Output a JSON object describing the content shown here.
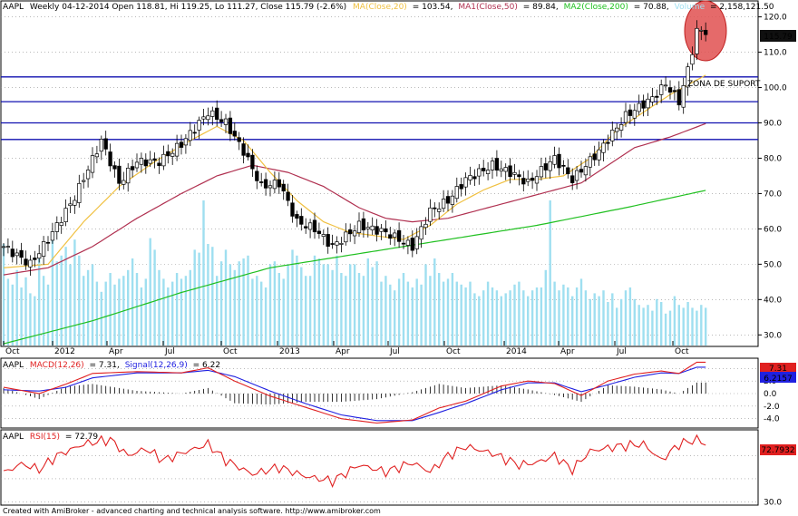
{
  "header": {
    "symbol": "AAPL",
    "info": "Weekly 04-12-2014 Open 118.81, Hi 119.25, Lo 111.27, Close 115.79 (-2.6%)",
    "ma_label": "MA(Close,20)",
    "ma_value": "= 103.54,",
    "ma1_label": "MA1(Close,50)",
    "ma1_value": "= 89.84,",
    "ma2_label": "MA2(Close,200)",
    "ma2_value": "= 70.88,",
    "volume_label": "Volume",
    "volume_value": "= 2,158,121.50"
  },
  "macd_header": {
    "symbol": "AAPL",
    "macd_label": "MACD(12,26)",
    "macd_value": "= 7.31,",
    "signal_label": "Signal(12,26,9)",
    "signal_value": "= 6.22"
  },
  "rsi_header": {
    "symbol": "AAPL",
    "rsi_label": "RSI(15)",
    "rsi_value": "= 72.79"
  },
  "annotation": "ZONA DE SUPORT",
  "footer": "Created with AmiBroker - advanced charting and technical analysis software. http://www.amibroker.com",
  "colors": {
    "ma20": "#f0c040",
    "ma50": "#b03050",
    "ma200": "#20c020",
    "volume": "#9fdff0",
    "support": "#1010b0",
    "macd": "#e02020",
    "signal": "#2020e0",
    "rsi": "#e02020",
    "highlight": "#e02020",
    "price_box": "#101010"
  },
  "chart_data": [
    {
      "type": "candlestick",
      "title": "AAPL Weekly",
      "x": [
        "Oct",
        "2012",
        "Apr",
        "Jul",
        "Oct",
        "2013",
        "Apr",
        "Jul",
        "Oct",
        "2014",
        "Apr",
        "Jul",
        "Oct"
      ],
      "yticks": [
        "120.0",
        "110.0",
        "100.0",
        "90.0",
        "80.0",
        "70.0",
        "60.0",
        "50.0",
        "40.0",
        "30.0"
      ],
      "ylim": [
        27,
        124
      ],
      "last_close": "115.79",
      "close_anchors": [
        [
          0,
          55
        ],
        [
          6,
          50
        ],
        [
          10,
          57
        ],
        [
          16,
          69
        ],
        [
          22,
          85
        ],
        [
          26,
          73
        ],
        [
          30,
          79
        ],
        [
          35,
          79
        ],
        [
          40,
          84
        ],
        [
          46,
          93
        ],
        [
          50,
          90
        ],
        [
          54,
          82
        ],
        [
          58,
          72
        ],
        [
          62,
          73
        ],
        [
          66,
          62
        ],
        [
          70,
          60
        ],
        [
          74,
          55
        ],
        [
          80,
          61
        ],
        [
          86,
          59
        ],
        [
          92,
          55
        ],
        [
          96,
          65
        ],
        [
          100,
          68
        ],
        [
          104,
          74
        ],
        [
          110,
          78
        ],
        [
          114,
          76
        ],
        [
          118,
          73
        ],
        [
          124,
          80
        ],
        [
          128,
          74
        ],
        [
          134,
          82
        ],
        [
          140,
          92
        ],
        [
          146,
          97
        ],
        [
          149,
          101
        ],
        [
          152,
          96
        ],
        [
          154,
          105
        ],
        [
          156,
          116
        ],
        [
          158,
          116
        ]
      ],
      "support_levels": [
        103,
        96,
        90,
        85.3
      ],
      "ma20_anchors": [
        [
          0,
          49
        ],
        [
          10,
          50
        ],
        [
          18,
          62
        ],
        [
          26,
          72
        ],
        [
          34,
          79
        ],
        [
          42,
          85
        ],
        [
          48,
          89
        ],
        [
          54,
          85
        ],
        [
          60,
          76
        ],
        [
          66,
          68
        ],
        [
          72,
          62
        ],
        [
          78,
          59
        ],
        [
          84,
          58
        ],
        [
          90,
          57
        ],
        [
          96,
          61
        ],
        [
          102,
          67
        ],
        [
          108,
          71
        ],
        [
          114,
          74
        ],
        [
          120,
          74
        ],
        [
          126,
          75
        ],
        [
          132,
          80
        ],
        [
          138,
          88
        ],
        [
          144,
          93
        ],
        [
          150,
          98
        ],
        [
          158,
          103.5
        ]
      ],
      "ma50_anchors": [
        [
          0,
          47
        ],
        [
          10,
          49
        ],
        [
          20,
          55
        ],
        [
          30,
          63
        ],
        [
          40,
          70
        ],
        [
          48,
          75
        ],
        [
          56,
          78
        ],
        [
          64,
          76
        ],
        [
          72,
          72
        ],
        [
          80,
          66
        ],
        [
          86,
          63
        ],
        [
          92,
          62
        ],
        [
          100,
          63
        ],
        [
          106,
          65
        ],
        [
          112,
          67
        ],
        [
          118,
          69
        ],
        [
          124,
          71
        ],
        [
          130,
          73
        ],
        [
          136,
          78
        ],
        [
          142,
          83
        ],
        [
          150,
          86
        ],
        [
          158,
          89.8
        ]
      ],
      "ma200_anchors": [
        [
          0,
          27.5
        ],
        [
          20,
          34
        ],
        [
          40,
          42
        ],
        [
          60,
          49
        ],
        [
          80,
          53
        ],
        [
          100,
          57
        ],
        [
          120,
          61
        ],
        [
          140,
          66
        ],
        [
          158,
          70.9
        ]
      ],
      "volume_values": [
        70,
        46,
        42,
        52,
        40,
        47,
        36,
        34,
        60,
        48,
        42,
        78,
        58,
        62,
        68,
        56,
        73,
        62,
        48,
        52,
        56,
        44,
        37,
        44,
        50,
        42,
        46,
        48,
        52,
        60,
        50,
        40,
        46,
        74,
        66,
        52,
        46,
        40,
        44,
        50,
        46,
        48,
        52,
        66,
        64,
        100,
        70,
        68,
        48,
        58,
        66,
        56,
        52,
        58,
        60,
        62,
        46,
        48,
        44,
        40,
        56,
        58,
        50,
        46,
        56,
        66,
        62,
        54,
        48,
        48,
        62,
        60,
        56,
        56,
        52,
        62,
        50,
        48,
        56,
        56,
        50,
        48,
        60,
        54,
        58,
        44,
        48,
        42,
        38,
        46,
        50,
        44,
        40,
        46,
        42,
        56,
        48,
        60,
        50,
        44,
        46,
        50,
        44,
        42,
        40,
        44,
        36,
        34,
        38,
        44,
        40,
        38,
        34,
        36,
        38,
        42,
        44,
        38,
        34,
        38,
        40,
        40,
        52,
        100,
        44,
        38,
        42,
        40,
        34,
        40,
        46,
        38,
        32,
        36,
        34,
        38,
        30,
        36,
        26,
        32,
        38,
        40,
        32,
        28,
        26,
        28,
        24,
        32,
        30,
        22,
        24,
        34,
        28,
        26,
        30,
        26,
        24,
        28,
        26
      ]
    },
    {
      "type": "line",
      "title": "MACD(12,26)",
      "yticks": [
        "4.0",
        "2.0",
        "0.0",
        "-2.0",
        "-4.0"
      ],
      "ylim": [
        -5.2,
        5.2
      ],
      "last_values": {
        "macd": "7.31",
        "signal": "6.2157"
      },
      "macd_anchors": [
        [
          0,
          1
        ],
        [
          8,
          0
        ],
        [
          14,
          1.5
        ],
        [
          20,
          3.2
        ],
        [
          30,
          3.5
        ],
        [
          40,
          3.3
        ],
        [
          46,
          4.1
        ],
        [
          52,
          2
        ],
        [
          60,
          -0.4
        ],
        [
          68,
          -2.2
        ],
        [
          76,
          -4
        ],
        [
          84,
          -4.7
        ],
        [
          92,
          -4.2
        ],
        [
          98,
          -2.3
        ],
        [
          104,
          -1.2
        ],
        [
          112,
          1.2
        ],
        [
          118,
          2
        ],
        [
          124,
          1.6
        ],
        [
          130,
          -0.3
        ],
        [
          136,
          2
        ],
        [
          142,
          3.1
        ],
        [
          148,
          3.6
        ],
        [
          152,
          3.2
        ],
        [
          156,
          5
        ]
      ],
      "signal_anchors": [
        [
          0,
          0.6
        ],
        [
          8,
          0.4
        ],
        [
          14,
          1
        ],
        [
          20,
          2.5
        ],
        [
          30,
          3.3
        ],
        [
          40,
          3.3
        ],
        [
          46,
          3.7
        ],
        [
          52,
          2.7
        ],
        [
          60,
          0.4
        ],
        [
          68,
          -1.6
        ],
        [
          76,
          -3.4
        ],
        [
          84,
          -4.3
        ],
        [
          92,
          -4.3
        ],
        [
          98,
          -3
        ],
        [
          104,
          -1.6
        ],
        [
          112,
          0.6
        ],
        [
          118,
          1.7
        ],
        [
          124,
          1.7
        ],
        [
          130,
          0.3
        ],
        [
          136,
          1.4
        ],
        [
          142,
          2.6
        ],
        [
          148,
          3.3
        ],
        [
          152,
          3.2
        ],
        [
          156,
          4.2
        ]
      ]
    },
    {
      "type": "line",
      "title": "RSI(15)",
      "yticks": [
        "30.0"
      ],
      "ylim": [
        28,
        90
      ],
      "last_value": "72.7932",
      "rsi_anchors": [
        [
          0,
          55
        ],
        [
          4,
          63
        ],
        [
          8,
          58
        ],
        [
          12,
          70
        ],
        [
          18,
          80
        ],
        [
          24,
          84
        ],
        [
          28,
          70
        ],
        [
          32,
          76
        ],
        [
          36,
          66
        ],
        [
          40,
          72
        ],
        [
          46,
          80
        ],
        [
          50,
          66
        ],
        [
          56,
          54
        ],
        [
          62,
          60
        ],
        [
          68,
          52
        ],
        [
          74,
          48
        ],
        [
          80,
          62
        ],
        [
          86,
          56
        ],
        [
          92,
          64
        ],
        [
          96,
          56
        ],
        [
          100,
          70
        ],
        [
          104,
          78
        ],
        [
          110,
          72
        ],
        [
          116,
          62
        ],
        [
          120,
          64
        ],
        [
          124,
          70
        ],
        [
          128,
          58
        ],
        [
          132,
          74
        ],
        [
          138,
          78
        ],
        [
          144,
          80
        ],
        [
          148,
          66
        ],
        [
          152,
          80
        ],
        [
          156,
          84
        ],
        [
          158,
          80
        ]
      ]
    }
  ]
}
